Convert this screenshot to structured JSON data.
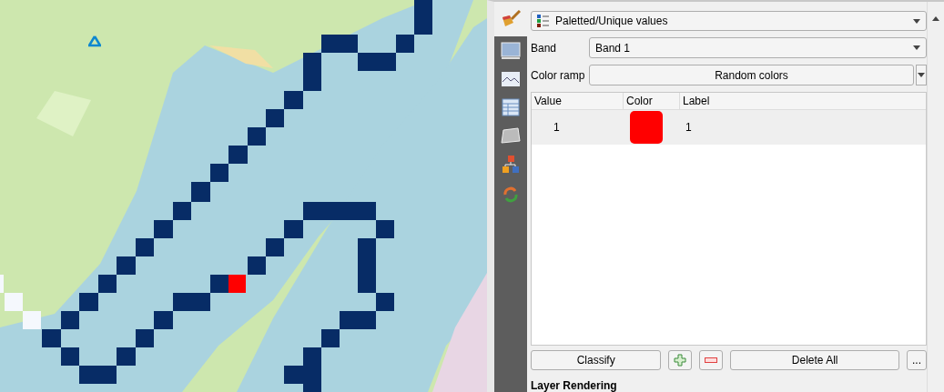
{
  "renderer": {
    "value": "Paletted/Unique values"
  },
  "band": {
    "label": "Band",
    "value": "Band 1"
  },
  "color_ramp": {
    "label": "Color ramp",
    "value": "Random colors"
  },
  "table": {
    "columns": [
      "Value",
      "Color",
      "Label"
    ],
    "rows": [
      {
        "value": "1",
        "color": "#ff0000",
        "label": "1"
      }
    ]
  },
  "buttons": {
    "classify": "Classify",
    "delete_all": "Delete All",
    "more": "..."
  },
  "section": "Layer Rendering"
}
